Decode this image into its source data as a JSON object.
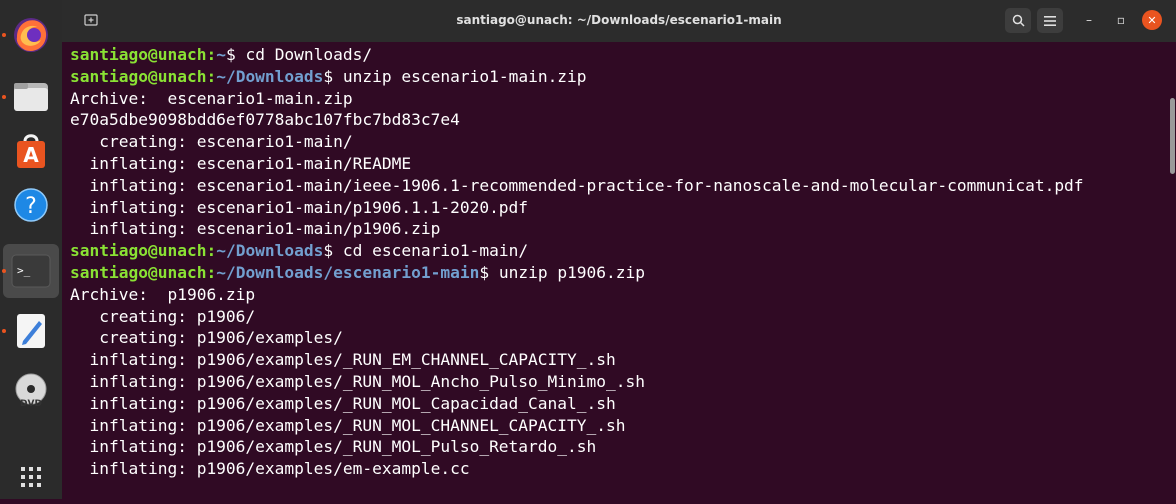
{
  "window": {
    "title": "santiago@unach: ~/Downloads/escenario1-main"
  },
  "titlebar": {
    "new_tab_icon": "new-tab-icon",
    "search_icon": "search-icon",
    "menu_icon": "hamburger-menu-icon",
    "minimize_label": "–",
    "maximize_label": "▫",
    "close_label": "✕"
  },
  "dock": {
    "items": [
      {
        "name": "firefox",
        "icon": "firefox-icon",
        "running": true
      },
      {
        "name": "files",
        "icon": "folder-icon",
        "running": true
      },
      {
        "name": "software",
        "icon": "store-icon",
        "running": false
      },
      {
        "name": "help",
        "icon": "help-icon",
        "running": false
      },
      {
        "name": "terminal",
        "icon": "terminal-icon",
        "running": true,
        "active": true
      },
      {
        "name": "text-editor",
        "icon": "text-editor-icon",
        "running": true
      },
      {
        "name": "dvd",
        "icon": "dvd-icon",
        "running": false
      },
      {
        "name": "show-apps",
        "icon": "app-grid-icon",
        "running": false
      }
    ]
  },
  "colors": {
    "terminal_bg": "#300a24",
    "user_host": "#8ae234",
    "path": "#729fcf",
    "text": "#ffffff"
  },
  "terminal": {
    "lines": [
      {
        "type": "prompt",
        "user": "santiago@unach",
        "sep": ":",
        "path": "~",
        "sym": "$ ",
        "cmd": "cd Downloads/"
      },
      {
        "type": "prompt",
        "user": "santiago@unach",
        "sep": ":",
        "path": "~/Downloads",
        "sym": "$ ",
        "cmd": "unzip escenario1-main.zip"
      },
      {
        "type": "out",
        "text": "Archive:  escenario1-main.zip"
      },
      {
        "type": "out",
        "text": "e70a5dbe9098bdd6ef0778abc107fbc7bd83c7e4"
      },
      {
        "type": "out",
        "text": "   creating: escenario1-main/"
      },
      {
        "type": "out",
        "text": "  inflating: escenario1-main/README"
      },
      {
        "type": "out",
        "text": "  inflating: escenario1-main/ieee-1906.1-recommended-practice-for-nanoscale-and-molecular-communicat.pdf"
      },
      {
        "type": "out",
        "text": "  inflating: escenario1-main/p1906.1.1-2020.pdf"
      },
      {
        "type": "out",
        "text": "  inflating: escenario1-main/p1906.zip"
      },
      {
        "type": "prompt",
        "user": "santiago@unach",
        "sep": ":",
        "path": "~/Downloads",
        "sym": "$ ",
        "cmd": "cd escenario1-main/"
      },
      {
        "type": "prompt",
        "user": "santiago@unach",
        "sep": ":",
        "path": "~/Downloads/escenario1-main",
        "sym": "$ ",
        "cmd": "unzip p1906.zip"
      },
      {
        "type": "out",
        "text": "Archive:  p1906.zip"
      },
      {
        "type": "out",
        "text": "   creating: p1906/"
      },
      {
        "type": "out",
        "text": "   creating: p1906/examples/"
      },
      {
        "type": "out",
        "text": "  inflating: p1906/examples/_RUN_EM_CHANNEL_CAPACITY_.sh"
      },
      {
        "type": "out",
        "text": "  inflating: p1906/examples/_RUN_MOL_Ancho_Pulso_Minimo_.sh"
      },
      {
        "type": "out",
        "text": "  inflating: p1906/examples/_RUN_MOL_Capacidad_Canal_.sh"
      },
      {
        "type": "out",
        "text": "  inflating: p1906/examples/_RUN_MOL_CHANNEL_CAPACITY_.sh"
      },
      {
        "type": "out",
        "text": "  inflating: p1906/examples/_RUN_MOL_Pulso_Retardo_.sh"
      },
      {
        "type": "out",
        "text": "  inflating: p1906/examples/em-example.cc"
      }
    ]
  }
}
